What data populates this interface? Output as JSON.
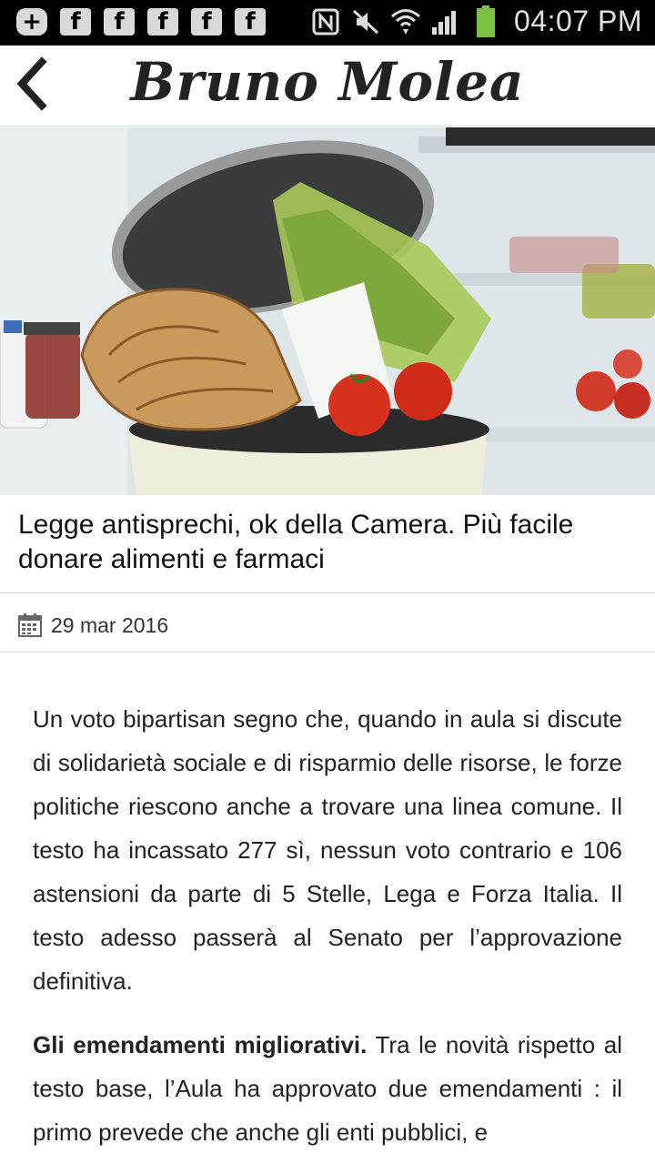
{
  "status_bar": {
    "time": "04:07 PM",
    "icons": [
      "plus-icon",
      "facebook-icon",
      "facebook-icon",
      "facebook-icon",
      "facebook-icon",
      "facebook-icon",
      "nfc-icon",
      "mute-icon",
      "wifi-icon",
      "signal-icon",
      "battery-icon"
    ]
  },
  "header": {
    "brand": "Bruno Molea",
    "back_icon": "chevron-left-icon"
  },
  "hero": {
    "image": "food-in-trash-bin-photo"
  },
  "article": {
    "title": "Legge antisprechi, ok della Camera. Più facile donare alimenti e farmaci",
    "date": "29 mar 2016",
    "paragraph1": "Un voto bipartisan segno che, quando in aula si discute di solidarietà sociale e di risparmio delle risorse, le forze politiche riescono anche a trovare una linea comune. Il testo ha incassato 277 sì, nessun voto contrario e 106 astensioni da parte di 5 Stelle, Lega e Forza Italia. Il testo adesso passerà al Senato per l’approvazione definitiva.",
    "paragraph2_lead": "Gli emendamenti migliorativi.",
    "paragraph2": " Tra le novità rispetto al testo base, l’Aula ha approvato due emendamenti : il primo prevede che anche gli enti pubblici, e"
  },
  "colors": {
    "statusbar_bg": "#000000",
    "accent_text": "#222222"
  }
}
